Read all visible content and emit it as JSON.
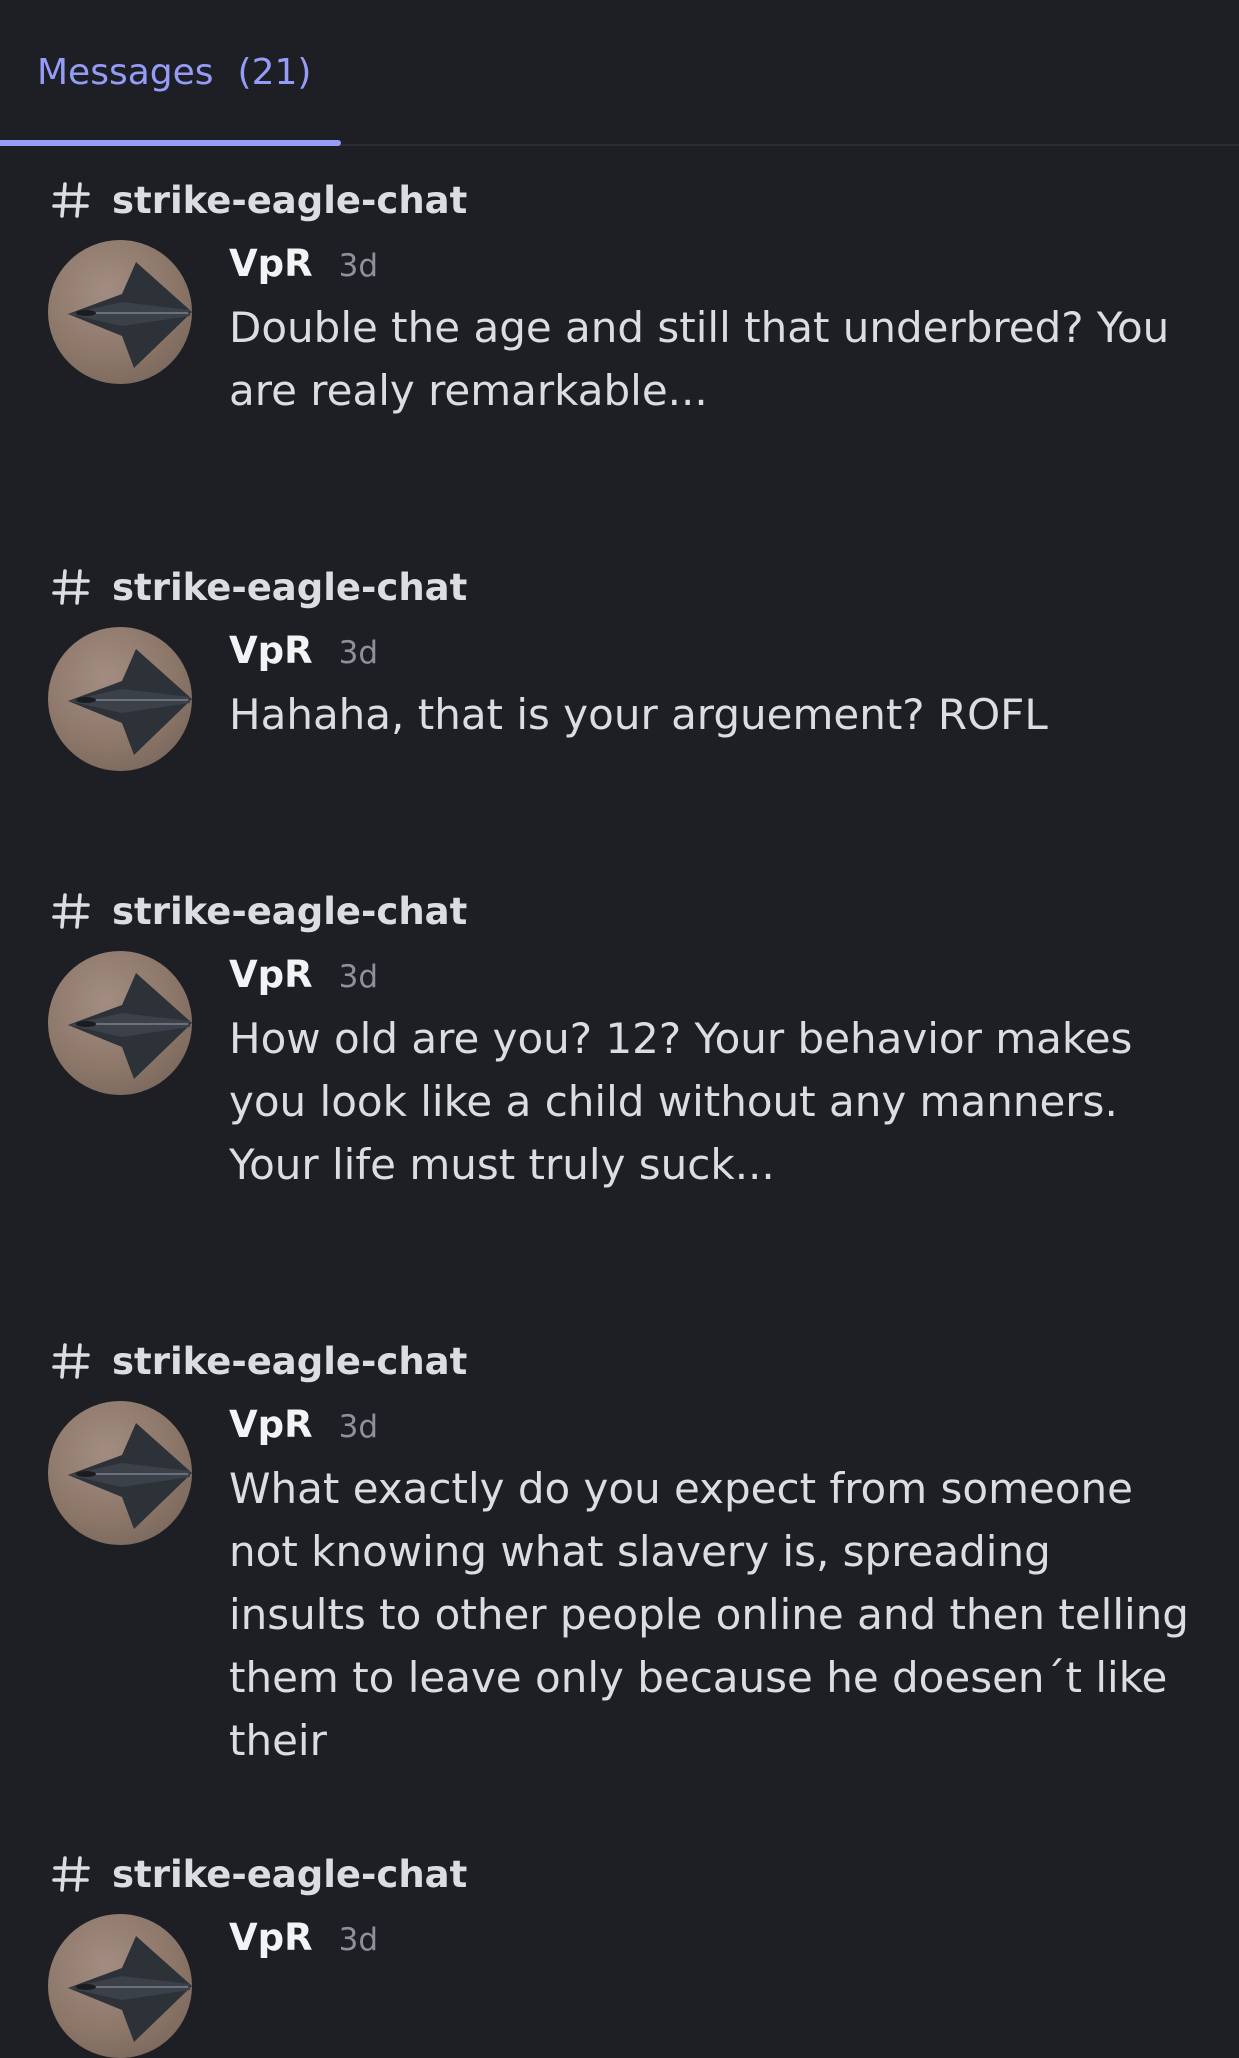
{
  "tabs": [
    {
      "label": "Messages",
      "count": "(21)",
      "active": true
    }
  ],
  "accent_color": "#949cf7",
  "background_color": "#1e1f24",
  "messages": [
    {
      "channel": "strike-eagle-chat",
      "author": "VpR",
      "time": "3d",
      "text": "Double the age and still that underbred? You are realy remarkable..."
    },
    {
      "channel": "strike-eagle-chat",
      "author": "VpR",
      "time": "3d",
      "text": "Hahaha, that is your arguement? ROFL"
    },
    {
      "channel": "strike-eagle-chat",
      "author": "VpR",
      "time": "3d",
      "text": "How old are you? 12? Your behavior makes you look like a child without any manners. Your life must truly suck..."
    },
    {
      "channel": "strike-eagle-chat",
      "author": "VpR",
      "time": "3d",
      "text": "What exactly do you expect from someone not knowing what slavery is, spreading insults to other people online and then telling them to leave only because he doesen´t like their"
    },
    {
      "channel": "strike-eagle-chat",
      "author": "VpR",
      "time": "3d",
      "text": ""
    }
  ]
}
